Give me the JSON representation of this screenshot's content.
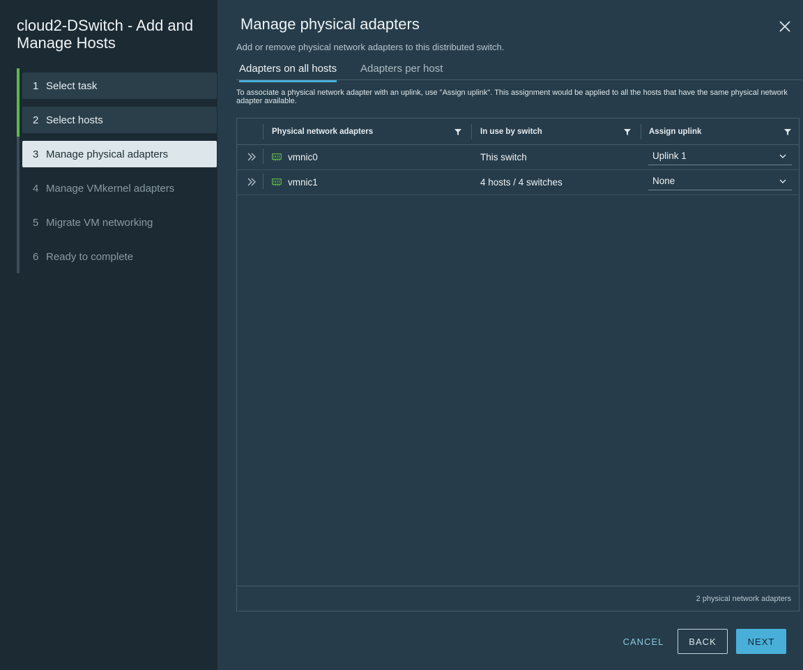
{
  "wizard": {
    "title": "cloud2-DSwitch - Add and Manage Hosts",
    "steps": [
      {
        "num": "1",
        "label": "Select task"
      },
      {
        "num": "2",
        "label": "Select hosts"
      },
      {
        "num": "3",
        "label": "Manage physical adapters"
      },
      {
        "num": "4",
        "label": "Manage VMkernel adapters"
      },
      {
        "num": "5",
        "label": "Migrate VM networking"
      },
      {
        "num": "6",
        "label": "Ready to complete"
      }
    ]
  },
  "page": {
    "title": "Manage physical adapters",
    "subtitle": "Add or remove physical network adapters to this distributed switch.",
    "close_icon": "close-icon"
  },
  "tabs": [
    {
      "label": "Adapters on all hosts"
    },
    {
      "label": "Adapters per host"
    }
  ],
  "note": "To associate a physical network adapter with an uplink, use \"Assign uplink\". This assignment would be applied to all the hosts that have the same physical network adapter available.",
  "grid": {
    "columns": [
      "Physical network adapters",
      "In use by switch",
      "Assign uplink"
    ],
    "rows": [
      {
        "adapter": "vmnic0",
        "in_use": "This switch",
        "uplink": "Uplink 1"
      },
      {
        "adapter": "vmnic1",
        "in_use": "4 hosts / 4 switches",
        "uplink": "None"
      }
    ],
    "footer": "2 physical network adapters"
  },
  "buttons": {
    "cancel": "CANCEL",
    "back": "BACK",
    "next": "NEXT"
  },
  "colors": {
    "accent": "#49afd9",
    "done_rail": "#5fb84a",
    "nic_icon": "#5fb84a"
  }
}
